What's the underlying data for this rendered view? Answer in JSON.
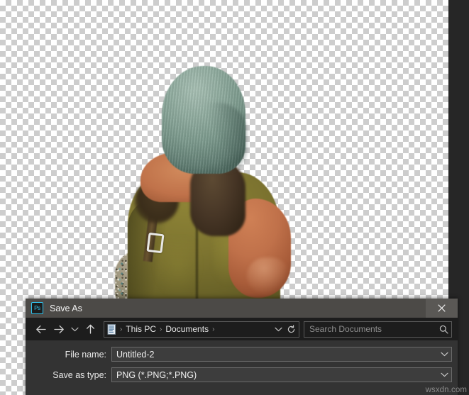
{
  "app": {
    "canvas_background": "transparent-checkerboard",
    "canvas_edge_color": "#262626"
  },
  "dialog": {
    "app_icon_label": "Ps",
    "title": "Save As",
    "close_label": "✕",
    "nav": {
      "back_label": "Back",
      "forward_label": "Forward",
      "recent_label": "Recent locations",
      "up_label": "Up"
    },
    "breadcrumb": {
      "doc_icon": "document-icon",
      "items": [
        "This PC",
        "Documents"
      ],
      "separator": "›",
      "trailing_separator": "›",
      "history_icon": "chevron-down-icon",
      "refresh_icon": "refresh-icon"
    },
    "search": {
      "placeholder": "Search Documents",
      "value": "",
      "icon": "search-icon"
    },
    "fields": {
      "file_name_label": "File name:",
      "file_name_value": "Untitled-2",
      "save_as_type_label": "Save as type:",
      "save_as_type_value": "PNG (*.PNG;*.PNG)",
      "dropdown_icon": "chevron-down-icon"
    },
    "colors": {
      "titlebar": "#4c4a47",
      "navbar": "#1d1d1d",
      "body": "#333333",
      "accent": "#31c5f0",
      "field": "#3d3d3d"
    }
  },
  "watermark": "wsxdn.com"
}
